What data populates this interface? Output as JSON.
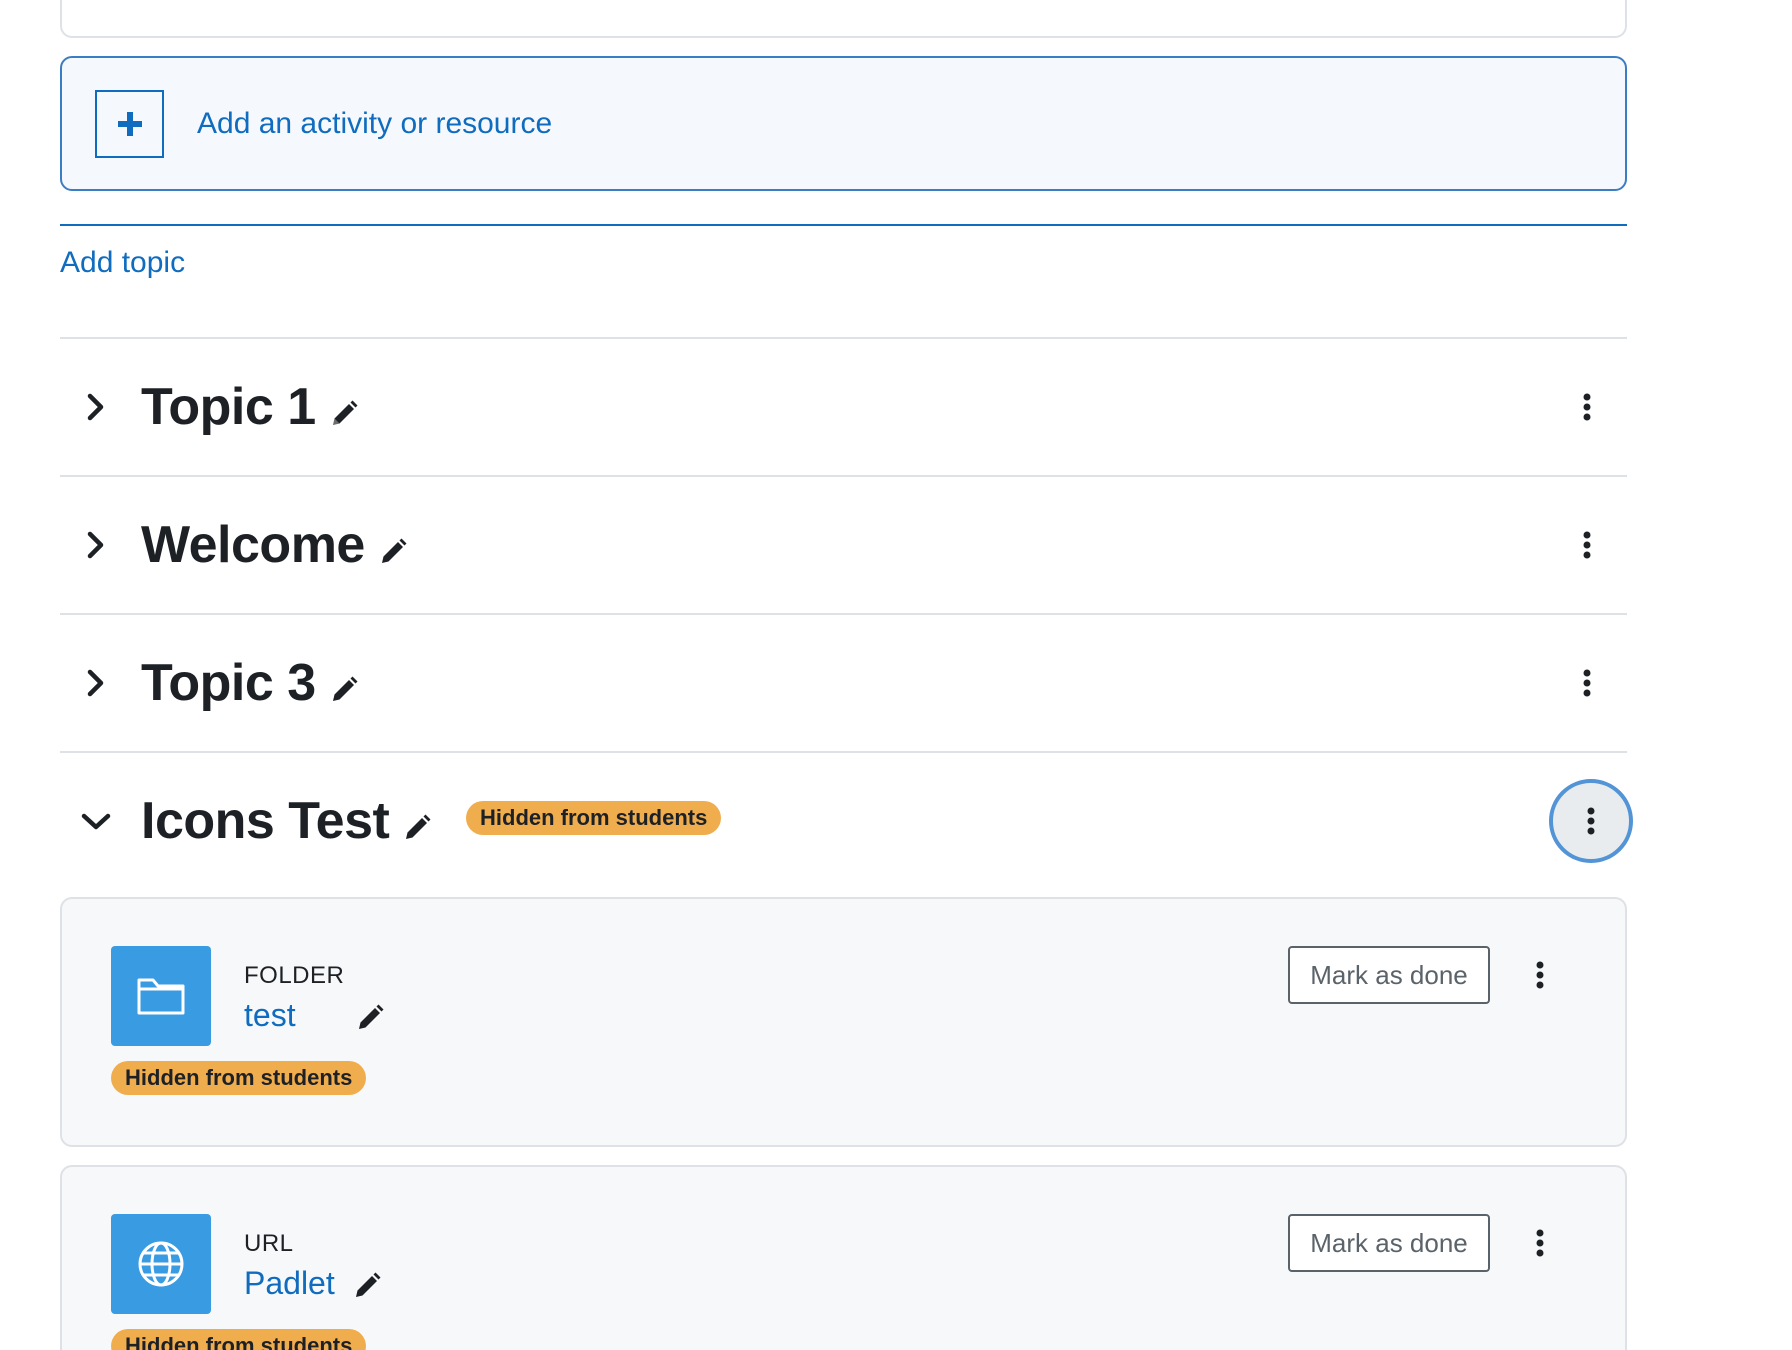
{
  "add_activity": {
    "label": "Add an activity or resource",
    "icon": "plus-icon"
  },
  "add_topic": {
    "label": "Add topic"
  },
  "sections": [
    {
      "title": "Topic 1",
      "collapsed": true
    },
    {
      "title": "Welcome",
      "collapsed": true
    },
    {
      "title": "Topic 3",
      "collapsed": true
    },
    {
      "title": "Icons Test",
      "collapsed": false,
      "badge": "Hidden from students"
    }
  ],
  "activities": [
    {
      "type": "FOLDER",
      "name": "test",
      "icon": "folder-icon",
      "badge": "Hidden from students",
      "completion_button": "Mark as done"
    },
    {
      "type": "URL",
      "name": "Padlet",
      "icon": "globe-icon",
      "badge": "Hidden from students",
      "completion_button": "Mark as done"
    }
  ],
  "colors": {
    "link": "#0f6cbf",
    "badge_warning": "#f0ad4e",
    "activity_icon_bg": "#399be2",
    "focus_ring": "#5294d6"
  }
}
